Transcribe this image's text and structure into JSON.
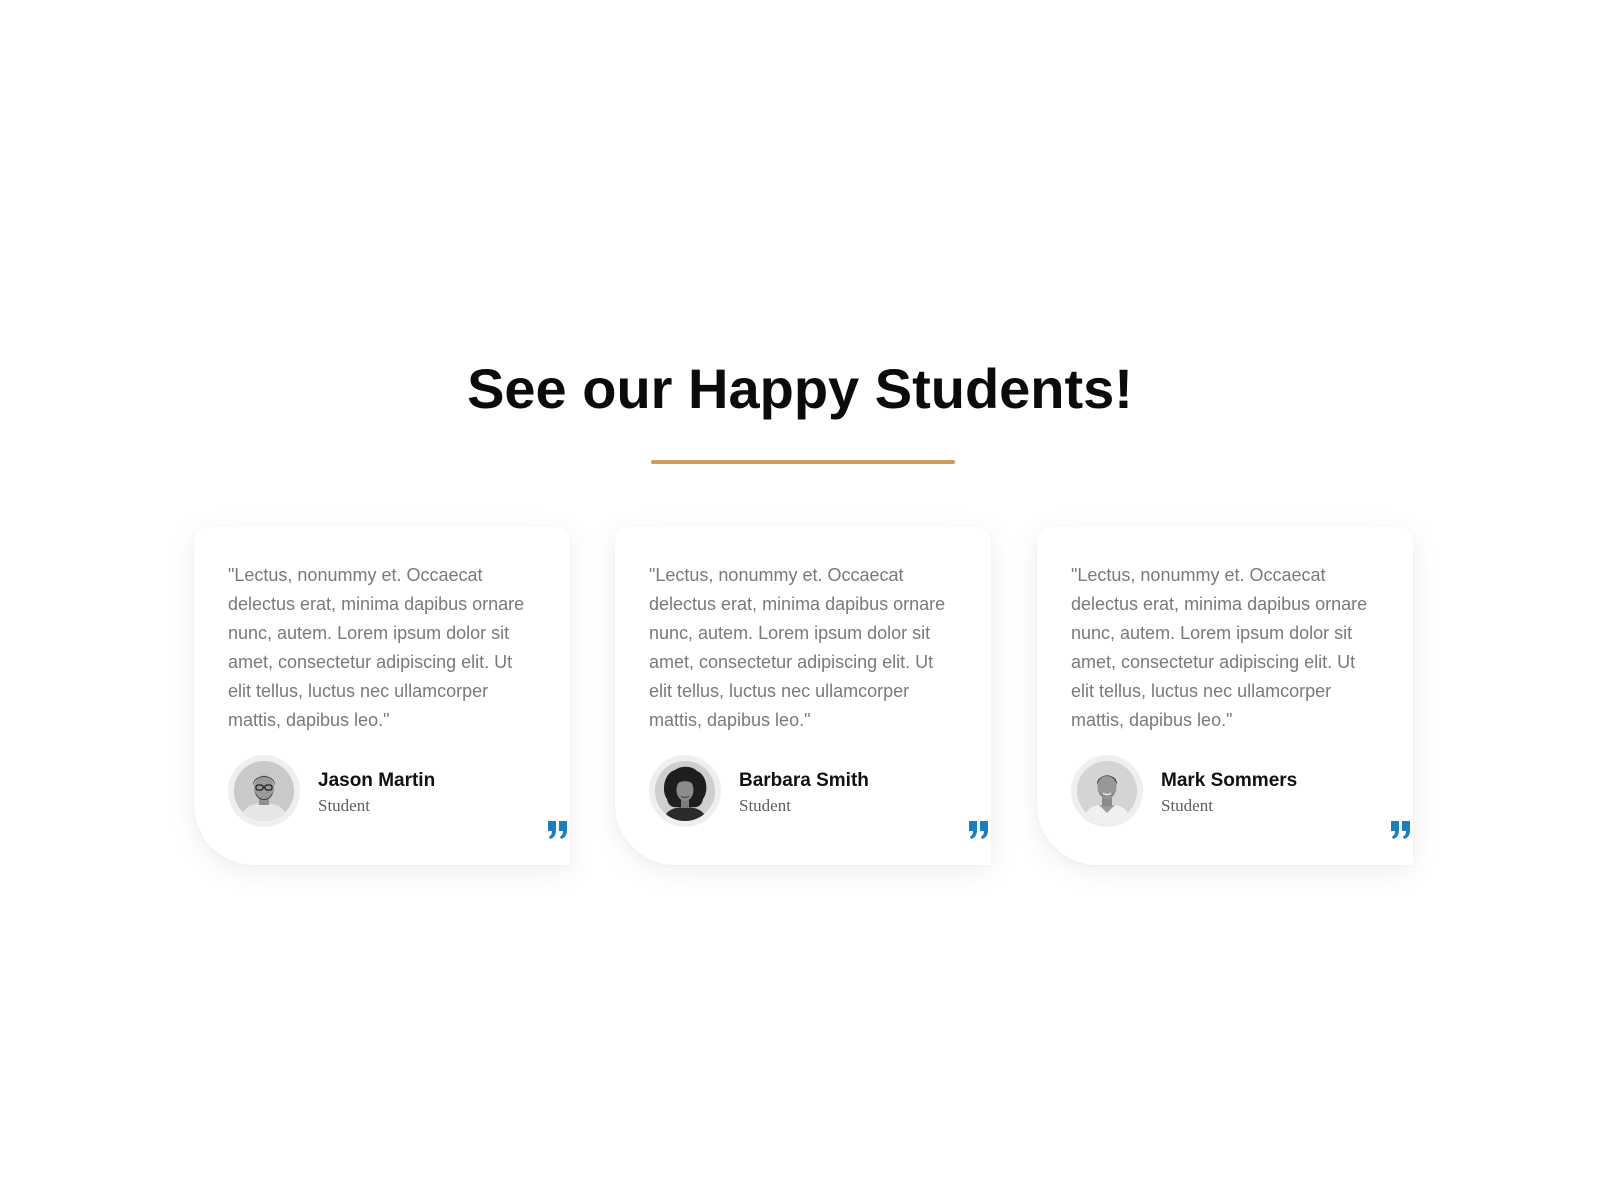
{
  "section": {
    "heading": "See our Happy Students!",
    "accent_color": "#cf9b55",
    "quote_icon_color": "#1a7fc1"
  },
  "testimonials": [
    {
      "quote": "\"Lectus, nonummy et. Occaecat delectus erat, minima dapibus ornare nunc, autem. Lorem ipsum dolor sit amet, consectetur adipiscing elit. Ut elit tellus, luctus nec ullamcorper mattis, dapibus leo.\"",
      "name": "Jason Martin",
      "role": "Student",
      "avatar_icon": "man-glasses-portrait"
    },
    {
      "quote": "\"Lectus, nonummy et. Occaecat delectus erat, minima dapibus ornare nunc, autem. Lorem ipsum dolor sit amet, consectetur adipiscing elit. Ut elit tellus, luctus nec ullamcorper mattis, dapibus leo.\"",
      "name": "Barbara Smith",
      "role": "Student",
      "avatar_icon": "woman-curly-hair-portrait"
    },
    {
      "quote": "\"Lectus, nonummy et. Occaecat delectus erat, minima dapibus ornare nunc, autem. Lorem ipsum dolor sit amet, consectetur adipiscing elit. Ut elit tellus, luctus nec ullamcorper mattis, dapibus leo.\"",
      "name": "Mark Sommers",
      "role": "Student",
      "avatar_icon": "man-short-hair-portrait"
    }
  ]
}
